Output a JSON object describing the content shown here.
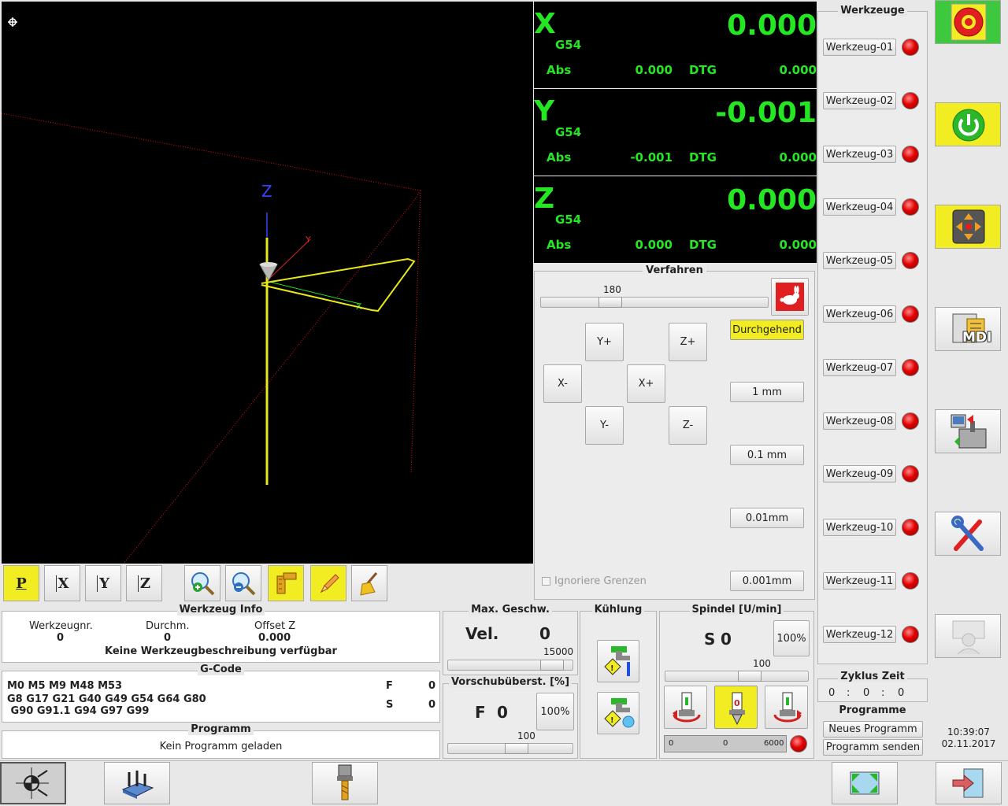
{
  "dro": {
    "x": {
      "axis": "X",
      "coord": "G54",
      "value": "0.000",
      "abs_label": "Abs",
      "abs_value": "0.000",
      "dtg_label": "DTG",
      "dtg_value": "0.000"
    },
    "y": {
      "axis": "Y",
      "coord": "G54",
      "value": "-0.001",
      "abs_label": "Abs",
      "abs_value": "-0.001",
      "dtg_label": "DTG",
      "dtg_value": "0.000"
    },
    "z": {
      "axis": "Z",
      "coord": "G54",
      "value": "0.000",
      "abs_label": "Abs",
      "abs_value": "0.000",
      "dtg_label": "DTG",
      "dtg_value": "0.000"
    }
  },
  "viewport": {
    "axis_z": "Z",
    "axis_y": "Y",
    "axis_x": "X"
  },
  "jog": {
    "title": "Verfahren",
    "speed_value": "180",
    "speed_fraction": 0.28,
    "buttons": {
      "y_plus": "Y+",
      "y_minus": "Y-",
      "x_plus": "X+",
      "x_minus": "X-",
      "z_plus": "Z+",
      "z_minus": "Z-"
    },
    "increments": [
      "Durchgehend",
      "1 mm",
      "0.1 mm",
      "0.01mm",
      "0.001mm"
    ],
    "ignore_limits": "Ignoriere Grenzen"
  },
  "view_buttons": {
    "p": "P",
    "x": "X",
    "y": "Y",
    "z": "Z"
  },
  "tools": {
    "title": "Werkzeuge",
    "items": [
      "Werkzeug-01",
      "Werkzeug-02",
      "Werkzeug-03",
      "Werkzeug-04",
      "Werkzeug-05",
      "Werkzeug-06",
      "Werkzeug-07",
      "Werkzeug-08",
      "Werkzeug-09",
      "Werkzeug-10",
      "Werkzeug-11",
      "Werkzeug-12"
    ]
  },
  "cycle": {
    "title": "Zyklus Zeit",
    "h": "0",
    "m": "0",
    "s": "0",
    "sep": ":"
  },
  "programs": {
    "title": "Programme",
    "new": "Neues Programm",
    "send": "Programm senden"
  },
  "clock": {
    "time": "10:39:07",
    "date": "02.11.2017"
  },
  "tool_info": {
    "title": "Werkzeug Info",
    "nr_label": "Werkzeugnr.",
    "nr_value": "0",
    "diam_label": "Durchm.",
    "diam_value": "0",
    "offset_label": "Offset Z",
    "offset_value": "0.000",
    "desc": "Keine Werkzeugbeschreibung verfügbar"
  },
  "gcode": {
    "title": "G-Code",
    "line1": "M0 M5 M9 M48 M53",
    "line2": "G8 G17 G21 G40 G49 G54 G64 G80",
    "line3": " G90 G91.1 G94 G97 G99",
    "f_label": "F",
    "f_value": "0",
    "s_label": "S",
    "s_value": "0"
  },
  "program": {
    "title": "Programm",
    "status": "Kein Programm geladen"
  },
  "max_speed": {
    "title": "Max. Geschw.",
    "label": "Vel.",
    "value": "0",
    "max": "15000",
    "fraction": 0.9
  },
  "feed_override": {
    "title": "Vorschubüberst. [%]",
    "label": "F",
    "value": "0",
    "reset": "100%",
    "scale": "100",
    "fraction": 0.55
  },
  "cooling": {
    "title": "Kühlung"
  },
  "spindle": {
    "title": "Spindel [U/min]",
    "label": "S",
    "value": "0",
    "reset": "100%",
    "scale": "100",
    "fraction": 0.6,
    "bar_min": "0",
    "bar_value": "0",
    "bar_max": "6000"
  },
  "right_buttons": {
    "mdi": "MDI"
  },
  "colors": {
    "dro_green": "#25e623",
    "toolpath_yellow": "#e8e81a",
    "led_red": "#e00000",
    "active_yellow": "#f2ec22"
  }
}
